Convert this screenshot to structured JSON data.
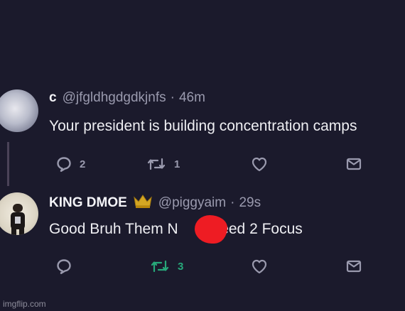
{
  "tweets": [
    {
      "name": "c",
      "handle": "@jfgldhgdgdkjnfs",
      "separator": "·",
      "time": "46m",
      "text": "Your president is building concentration camps",
      "actions": {
        "reply_count": "2",
        "retweet_count": "1",
        "like_count": ""
      }
    },
    {
      "name": "KING DMOE",
      "handle": "@piggyaim",
      "separator": "·",
      "time": "29s",
      "text_before": "Good Bruh Them N",
      "text_after": "s Need 2 Focus",
      "actions": {
        "reply_count": "",
        "retweet_count": "3",
        "like_count": ""
      }
    }
  ],
  "colors": {
    "background": "#1b1a2c",
    "retweet_active": "#27a87a",
    "redaction": "#ee1c23",
    "icon": "#9a9aae"
  },
  "icons": [
    "reply-icon",
    "retweet-icon",
    "like-icon",
    "share-icon",
    "crown-icon"
  ],
  "watermark": "imgflip.com"
}
